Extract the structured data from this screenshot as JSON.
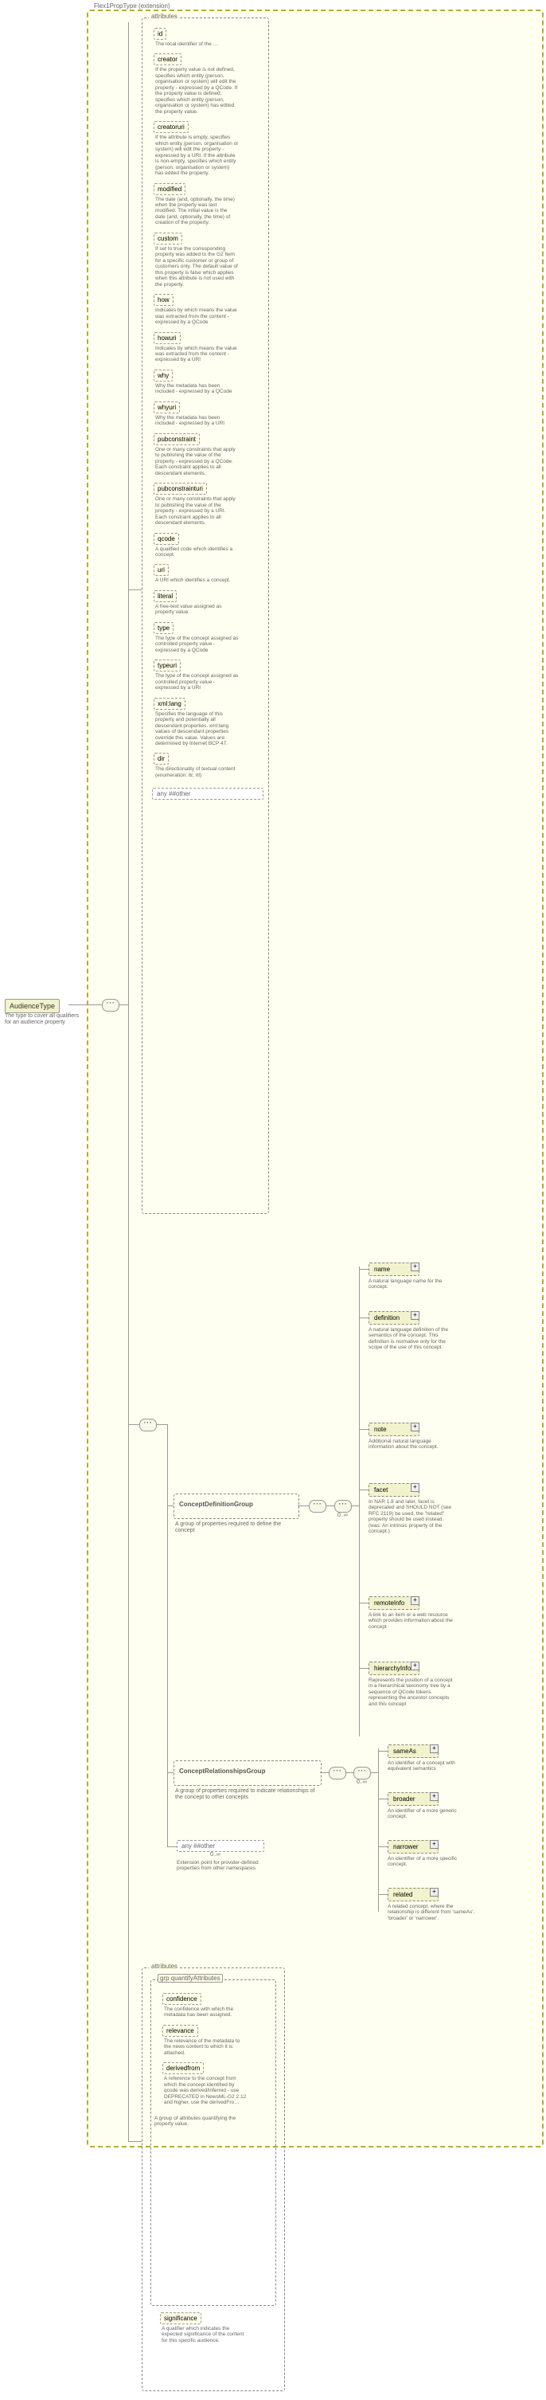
{
  "extension_label": "Flex1PropType (extension)",
  "root": {
    "label": "AudienceType",
    "desc": "The type to cover all qualifiers for an audience property"
  },
  "attr_section_title": "attributes",
  "attrs": [
    {
      "name": "id",
      "desc": "The local identifier of the …"
    },
    {
      "name": "creator",
      "desc": "If the property value is not defined, specifies which entity (person, organisation or system) will edit the property - expressed by a QCode. If the property value is defined, specifies which entity (person, organisation or system) has edited the property value."
    },
    {
      "name": "creatoruri",
      "desc": "If the attribute is empty, specifies which entity (person, organisation or system) will edit the property - expressed by a URI. If the attribute is non-empty, specifies which entity (person, organisation or system) has edited the property."
    },
    {
      "name": "modified",
      "desc": "The date (and, optionally, the time) when the property was last modified. The initial value is the date (and, optionally, the time) of creation of the property."
    },
    {
      "name": "custom",
      "desc": "If set to true the corresponding property was added to the G2 Item for a specific customer or group of customers only. The default value of this property is false which applies when this attribute is not used with the property."
    },
    {
      "name": "how",
      "desc": "Indicates by which means the value was extracted from the content - expressed by a QCode"
    },
    {
      "name": "howuri",
      "desc": "Indicates by which means the value was extracted from the content - expressed by a URI"
    },
    {
      "name": "why",
      "desc": "Why the metadata has been included - expressed by a QCode"
    },
    {
      "name": "whyuri",
      "desc": "Why the metadata has been included - expressed by a URI"
    },
    {
      "name": "pubconstraint",
      "desc": "One or many constraints that apply to publishing the value of the property - expressed by a QCode. Each constraint applies to all descendant elements."
    },
    {
      "name": "pubconstrainturi",
      "desc": "One or many constraints that apply to publishing the value of the property - expressed by a URI. Each constraint applies to all descendant elements."
    },
    {
      "name": "qcode",
      "desc": "A qualified code which identifies a concept."
    },
    {
      "name": "uri",
      "desc": "A URI which identifies a concept."
    },
    {
      "name": "literal",
      "desc": "A free-text value assigned as property value."
    },
    {
      "name": "type",
      "desc": "The type of the concept assigned as controlled property value - expressed by a QCode"
    },
    {
      "name": "typeuri",
      "desc": "The type of the concept assigned as controlled property value - expressed by a URI"
    },
    {
      "name": "xml:lang",
      "desc": "Specifies the language of this property and potentially all descendant properties. xml:lang values of descendant properties override this value. Values are determined by Internet BCP 47."
    },
    {
      "name": "dir",
      "desc": "The directionality of textual content (enumeration: ltr, rtl)"
    }
  ],
  "any_other": "any ##other",
  "groups": {
    "def": {
      "title": "ConceptDefinitionGroup",
      "desc": "A group of properties required to define the concept"
    },
    "rel": {
      "title": "ConceptRelationshipsGroup",
      "desc": "A group of properties required to indicate relationships of the concept to other concepts"
    }
  },
  "def_elements": [
    {
      "name": "name",
      "desc": "A natural language name for the concept."
    },
    {
      "name": "definition",
      "desc": "A natural language definition of the semantics of the concept. This definition is normative only for the scope of the use of this concept."
    },
    {
      "name": "note",
      "desc": "Additional natural language information about the concept."
    },
    {
      "name": "facet",
      "desc": "In NAR 1.8 and later, facet is deprecated and SHOULD NOT (see RFC 2119) be used, the \"related\" property should be used instead. (was: An intrinsic property of the concept.)"
    },
    {
      "name": "remoteInfo",
      "desc": "A link to an item or a web resource which provides information about the concept"
    },
    {
      "name": "hierarchyInfo",
      "desc": "Represents the position of a concept in a hierarchical taxonomy tree by a sequence of QCode tokens representing the ancestor concepts and this concept"
    }
  ],
  "rel_elements": [
    {
      "name": "sameAs",
      "desc": "An identifier of a concept with equivalent semantics"
    },
    {
      "name": "broader",
      "desc": "An identifier of a more generic concept."
    },
    {
      "name": "narrower",
      "desc": "An identifier of a more specific concept."
    },
    {
      "name": "related",
      "desc": "A related concept, where the relationship is different from 'sameAs', 'broader' or 'narrower'."
    }
  ],
  "ext_point": {
    "label": "any ##other",
    "desc": "Extension point for provider-defined properties from other namespaces"
  },
  "quantify": {
    "title": "attributes",
    "grp": "grp quantifyAttributes",
    "desc": "A group of attributes quantifying the property value.",
    "items": [
      {
        "name": "confidence",
        "desc": "The confidence with which the metadata has been assigned."
      },
      {
        "name": "relevance",
        "desc": "The relevance of the metadata to the news content to which it is attached."
      },
      {
        "name": "derivedfrom",
        "desc": "A reference to the concept from which the concept identified by qcode was derived/inferred - use DEPRECATED in NewsML-G2 2.12 and higher, use the derivedFro…"
      }
    ],
    "significance": {
      "name": "significance",
      "desc": "A qualifier which indicates the expected significance of the content for this specific audience."
    }
  },
  "occ": "0..∞"
}
